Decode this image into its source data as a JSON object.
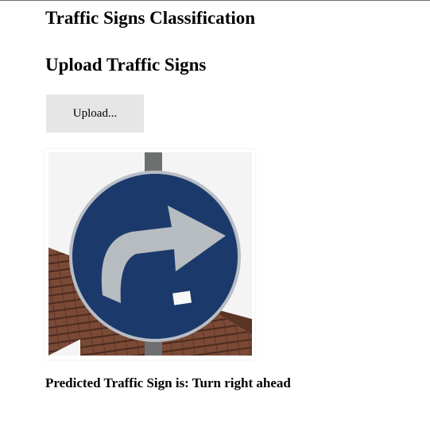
{
  "app": {
    "title": "Traffic Signs Classification"
  },
  "upload": {
    "heading": "Upload Traffic Signs",
    "button_label": "Upload..."
  },
  "preview": {
    "sign_icon": "turn-right-ahead-sign",
    "colors": {
      "sign_blue": "#1b3a6b",
      "arrow_grey": "#b7bcc0",
      "roof_brown": "#7a4a36",
      "pole_grey": "#6d6f70"
    }
  },
  "result": {
    "prediction_text": "Predicted Traffic Sign is: Turn right ahead"
  }
}
